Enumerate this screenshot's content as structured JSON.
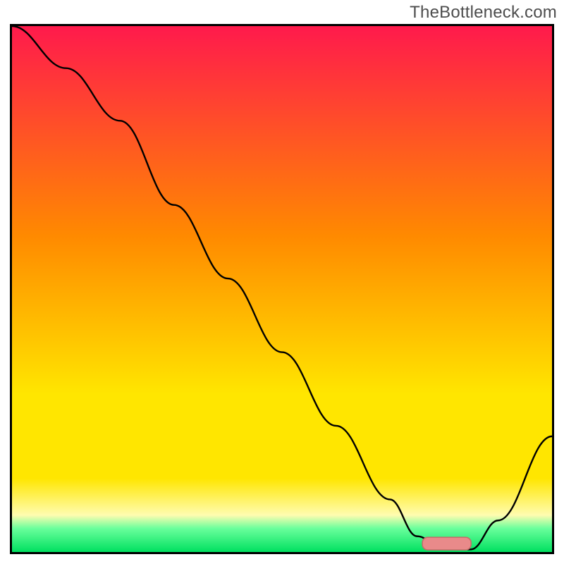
{
  "watermark": "TheBottleneck.com",
  "colors": {
    "gradient_top": "#ff1a4c",
    "gradient_mid1": "#ff8a00",
    "gradient_mid2": "#ffe600",
    "gradient_lightband": "#fffcb0",
    "gradient_green_top": "#6aff9c",
    "gradient_green": "#00e060",
    "curve": "#000000",
    "marker_fill": "#e98a8a",
    "marker_stroke": "#c76a6a",
    "frame": "#000000"
  },
  "chart_data": {
    "type": "line",
    "title": "",
    "xlabel": "",
    "ylabel": "",
    "x": [
      0,
      10,
      20,
      30,
      40,
      50,
      60,
      70,
      75,
      80,
      85,
      90,
      100
    ],
    "values": [
      100,
      92,
      82,
      66,
      52,
      38,
      24,
      10,
      3,
      0.5,
      0.5,
      6,
      22
    ],
    "xlim": [
      0,
      100
    ],
    "ylim": [
      0,
      100
    ],
    "marker": {
      "x_start": 76,
      "x_end": 85,
      "y": 1.6
    }
  }
}
